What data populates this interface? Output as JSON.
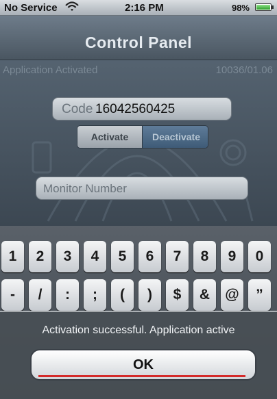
{
  "status_bar": {
    "carrier": "No Service",
    "time": "2:16 PM",
    "battery_percent": "98%",
    "battery_color": "#2e9d2c"
  },
  "nav": {
    "title": "Control Panel"
  },
  "info": {
    "status": "Application Activated",
    "version": "10036/01.06"
  },
  "code_field": {
    "label": "Code",
    "value": "16042560425"
  },
  "segment": {
    "activate": "Activate",
    "deactivate": "Deactivate"
  },
  "monitor_field": {
    "placeholder": "Monitor Number"
  },
  "keyboard": {
    "row1": [
      "1",
      "2",
      "3",
      "4",
      "5",
      "6",
      "7",
      "8",
      "9",
      "0"
    ],
    "row2": [
      "-",
      "/",
      ":",
      ";",
      "(",
      ")",
      "$",
      "&",
      "@",
      "”"
    ]
  },
  "alert": {
    "message": "Activation successful. Application active",
    "ok_label": "OK",
    "accent": "#d42a2a"
  }
}
